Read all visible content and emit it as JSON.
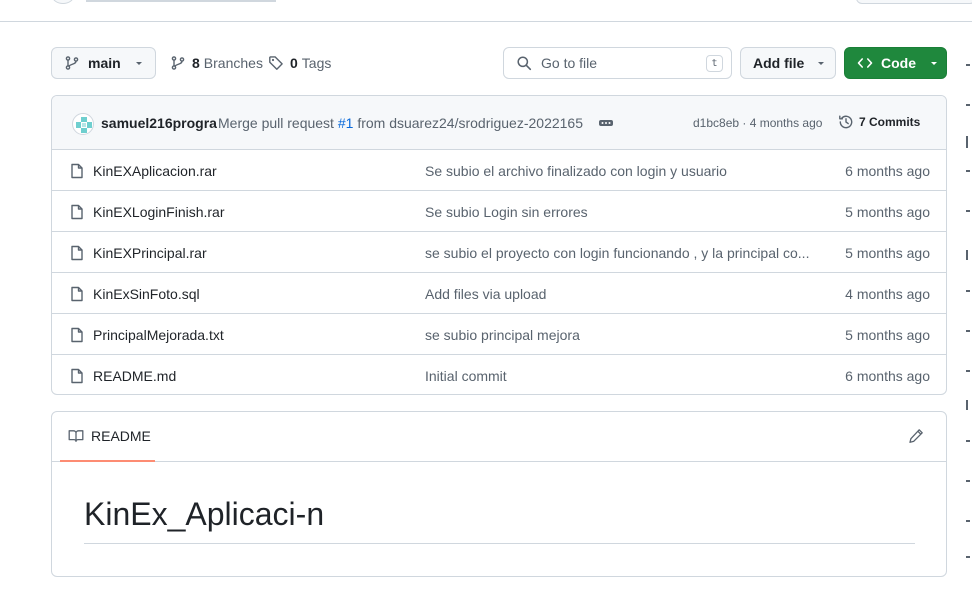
{
  "branch": {
    "label": "main"
  },
  "meta": {
    "branches_count": "8",
    "branches_label": "Branches",
    "tags_count": "0",
    "tags_label": "Tags"
  },
  "search": {
    "placeholder": "Go to file",
    "shortcut": "t"
  },
  "toolbar": {
    "add_file_label": "Add file",
    "code_label": "Code"
  },
  "commit": {
    "author": "samuel216progra",
    "message_prefix": "Merge pull request",
    "pr_ref": "#1",
    "message_suffix": "from dsuarez24/srodriguez-2022165",
    "sha": "d1bc8eb",
    "age": "4 months ago",
    "sha_age": "d1bc8eb · 4 months ago",
    "count_label": "7 Commits"
  },
  "files": [
    {
      "name": "KinEXAplicacion.rar",
      "message": "Se subio el archivo finalizado con login y usuario",
      "date": "6 months ago"
    },
    {
      "name": "KinEXLoginFinish.rar",
      "message": "Se subio Login sin errores",
      "date": "5 months ago"
    },
    {
      "name": "KinEXPrincipal.rar",
      "message": "se subio el proyecto con login funcionando , y la principal co...",
      "date": "5 months ago"
    },
    {
      "name": "KinExSinFoto.sql",
      "message": "Add files via upload",
      "date": "4 months ago"
    },
    {
      "name": "PrincipalMejorada.txt",
      "message": "se subio principal mejora",
      "date": "5 months ago"
    },
    {
      "name": "README.md",
      "message": "Initial commit",
      "date": "6 months ago"
    }
  ],
  "readme": {
    "tab_label": "README",
    "title": "KinEx_Aplicaci-n"
  },
  "colors": {
    "primary_button": "#1f883d",
    "link": "#0969da",
    "muted_text": "#59636e",
    "border": "#d0d7de",
    "tab_underline": "#fd8c73"
  }
}
